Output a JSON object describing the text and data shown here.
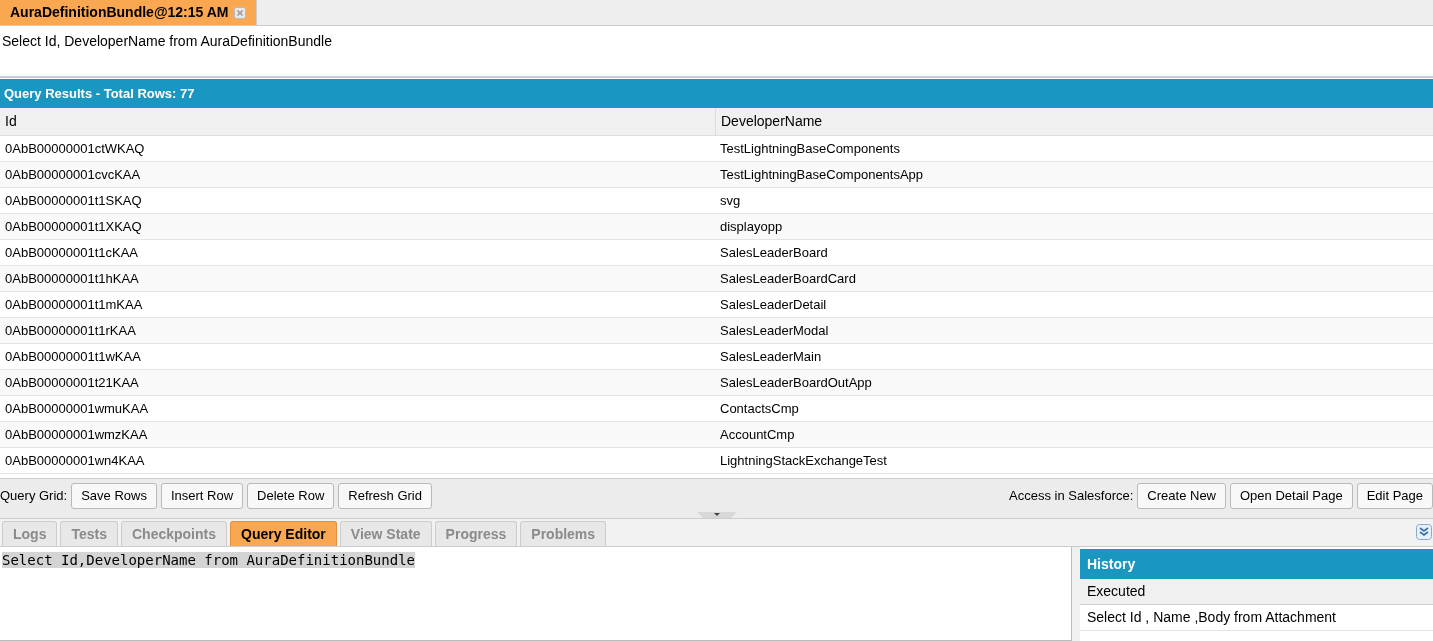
{
  "doc_tabs": [
    {
      "label": "AuraDefinitionBundle@12:15 AM",
      "selected": true
    }
  ],
  "query_text": "Select Id, DeveloperName from AuraDefinitionBundle",
  "results": {
    "title": "Query Results - Total Rows: 77",
    "columns": [
      "Id",
      "DeveloperName"
    ],
    "rows": [
      [
        "0AbB00000001ctWKAQ",
        "TestLightningBaseComponents"
      ],
      [
        "0AbB00000001cvcKAA",
        "TestLightningBaseComponentsApp"
      ],
      [
        "0AbB00000001t1SKAQ",
        "svg"
      ],
      [
        "0AbB00000001t1XKAQ",
        "displayopp"
      ],
      [
        "0AbB00000001t1cKAA",
        "SalesLeaderBoard"
      ],
      [
        "0AbB00000001t1hKAA",
        "SalesLeaderBoardCard"
      ],
      [
        "0AbB00000001t1mKAA",
        "SalesLeaderDetail"
      ],
      [
        "0AbB00000001t1rKAA",
        "SalesLeaderModal"
      ],
      [
        "0AbB00000001t1wKAA",
        "SalesLeaderMain"
      ],
      [
        "0AbB00000001t21KAA",
        "SalesLeaderBoardOutApp"
      ],
      [
        "0AbB00000001wmuKAA",
        "ContactsCmp"
      ],
      [
        "0AbB00000001wmzKAA",
        "AccountCmp"
      ],
      [
        "0AbB00000001wn4KAA",
        "LightningStackExchangeTest"
      ]
    ]
  },
  "grid_toolbar": {
    "label": "Query Grid:",
    "buttons": [
      "Save Rows",
      "Insert Row",
      "Delete Row",
      "Refresh Grid"
    ],
    "access_label": "Access in Salesforce:",
    "access_buttons": [
      "Create New",
      "Open Detail Page",
      "Edit Page"
    ]
  },
  "panel_tabs": [
    {
      "label": "Logs",
      "selected": false
    },
    {
      "label": "Tests",
      "selected": false
    },
    {
      "label": "Checkpoints",
      "selected": false
    },
    {
      "label": "Query Editor",
      "selected": true
    },
    {
      "label": "View State",
      "selected": false
    },
    {
      "label": "Progress",
      "selected": false
    },
    {
      "label": "Problems",
      "selected": false
    }
  ],
  "editor_text": "Select Id,DeveloperName from AuraDefinitionBundle",
  "history": {
    "title": "History",
    "column": "Executed",
    "rows": [
      "Select Id , Name ,Body from Attachment"
    ]
  }
}
